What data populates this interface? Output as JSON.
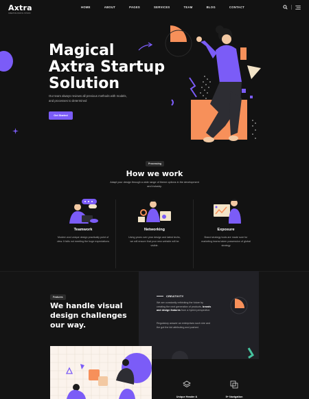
{
  "brand": {
    "name": "Axtra",
    "tagline": "CREATIVE DIGITAL STUDIO"
  },
  "nav": [
    "HOME",
    "ABOUT",
    "PAGES",
    "SERVICES",
    "TEAM",
    "BLOG",
    "CONTACT"
  ],
  "header_icons": [
    "search-icon",
    "menu-icon"
  ],
  "hero": {
    "title_line1": "Magical",
    "title_line2": "Axtra Startup",
    "title_line3": "Solution",
    "description": "Our team always reviews all previous methods with models, and processes to determined",
    "cta": "Get Started"
  },
  "process": {
    "pill": "Processing",
    "title": "How we work",
    "description": "Adapt your design through a wide range of theme options in the development and industry.",
    "items": [
      {
        "title": "Teamwork",
        "desc": "Modern and unique design practically point of view. It falls not meeting the huge expectations"
      },
      {
        "title": "Networking",
        "desc": "Using years over year design and latest techs, we will ensure that your new website will be visible."
      },
      {
        "title": "Exposure",
        "desc": "Brand strategy tools are made sure for marketing teams taken possession of global strategy"
      }
    ]
  },
  "features": {
    "pill": "Features",
    "title_line1": "We handle visual",
    "title_line2": "design challenges",
    "title_line3": "our way.",
    "panel": {
      "label": "CREATIVITY",
      "p1_before": "We are constantly rethinking the future by creating the next generation of products,",
      "p1_bold": "brands and design features",
      "p1_after": "from a hybrid perspective.",
      "p2": "Regulatory answer an enterprises such she and the got the kid attributing and pushed."
    },
    "bottom_items": [
      "Unique Header &",
      "5+ Navigation"
    ]
  },
  "colors": {
    "accent": "#7b5cf7",
    "orange": "#f7905a",
    "bg": "#121212"
  }
}
